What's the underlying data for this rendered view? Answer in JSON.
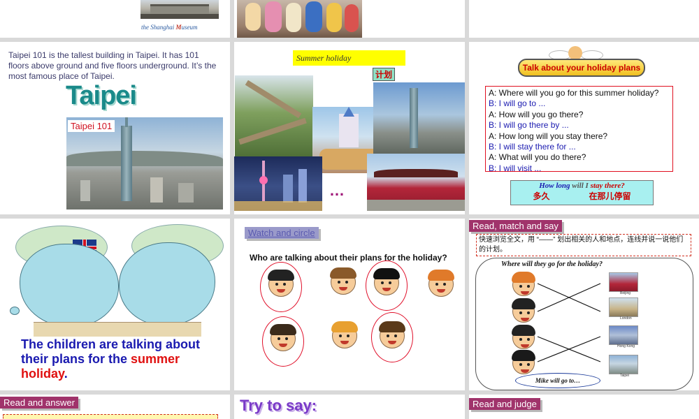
{
  "slide1": {
    "caption_pre": "the Shanghai ",
    "caption_m": "M",
    "caption_post": "useum"
  },
  "taipei": {
    "paragraph": "Taipei 101 is the tallest building in Taipei. It has 101 floors above ground and five floors underground. It’s the most famous place of Taipei.",
    "title": "Taipei",
    "photo_label": "Taipei 101"
  },
  "summer": {
    "title": "Summer holiday",
    "plan_label": "计划",
    "ellipsis": "…"
  },
  "plans": {
    "banner": "Talk about your holiday plans",
    "dialog": [
      {
        "speaker": "A",
        "text": "A: Where will you go for this summer holiday?"
      },
      {
        "speaker": "B",
        "text": "B: I will go to ..."
      },
      {
        "speaker": "A",
        "text": "A: How will you go there?"
      },
      {
        "speaker": "B",
        "text": "B: I will go there by ..."
      },
      {
        "speaker": "A",
        "text": "A: How long will you stay there?"
      },
      {
        "speaker": "B",
        "text": "B: I will stay there for ..."
      },
      {
        "speaker": "A",
        "text": "A: What will you do there?"
      },
      {
        "speaker": "B",
        "text": "B: I will visit ..."
      }
    ],
    "note_en_1": "How long",
    "note_en_2": " will I ",
    "note_en_3": "stay there?",
    "note_cn_1": "多久",
    "note_cn_2": "在那儿停留"
  },
  "children": {
    "text_1": "The children are talking about their plans for the ",
    "text_highlight": "summer holiday",
    "text_end": "."
  },
  "watch": {
    "tag": "Watch and circle",
    "question": "Who are talking about their plans for the holiday?"
  },
  "match": {
    "tag": "Read, match and say",
    "instruction": "快速浏览全文，用 “——” 划出相关的人和地点，连线并说一说他们的计划。",
    "question": "Where will they go for the holiday?",
    "places": [
      "Beijing",
      "London",
      "Hong Kong",
      "Taipei"
    ],
    "bubble": "Mike will go to…"
  },
  "bottom": {
    "read_answer": "Read and answer",
    "try_say": "Try to say:",
    "read_judge": "Read and judge"
  },
  "colors": {
    "tag_bg": "#a0336b",
    "blue_text": "#1a1ab0",
    "red_text": "#e01010",
    "title_teal": "#1a8a8a"
  }
}
